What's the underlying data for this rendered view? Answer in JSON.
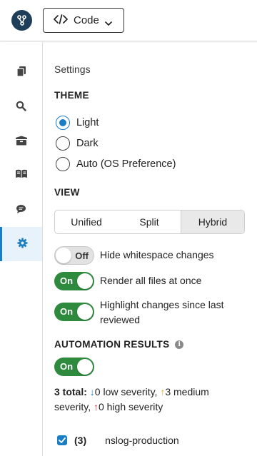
{
  "header": {
    "logo_icon": "git-branch-icon",
    "code_button": {
      "label": "Code",
      "icon": "code-brackets-icon"
    }
  },
  "sidebar": {
    "items": [
      {
        "name": "files",
        "icon": "copy-icon",
        "active": false
      },
      {
        "name": "search",
        "icon": "search-icon",
        "active": false
      },
      {
        "name": "packages",
        "icon": "box-icon",
        "active": false
      },
      {
        "name": "docs",
        "icon": "book-icon",
        "active": false
      },
      {
        "name": "comments",
        "icon": "chat-icon",
        "active": false
      },
      {
        "name": "settings",
        "icon": "gear-icon",
        "active": true
      }
    ]
  },
  "settings": {
    "title": "Settings",
    "theme": {
      "heading": "THEME",
      "options": [
        "Light",
        "Dark",
        "Auto (OS Preference)"
      ],
      "selected": "Light"
    },
    "view": {
      "heading": "VIEW",
      "options": [
        "Unified",
        "Split",
        "Hybrid"
      ],
      "selected": "Hybrid"
    },
    "toggles": [
      {
        "state": "Off",
        "label": "Hide whitespace changes"
      },
      {
        "state": "On",
        "label": "Render all files at once"
      },
      {
        "state": "On",
        "label": "Highlight changes since last reviewed"
      }
    ],
    "automation": {
      "heading": "AUTOMATION RESULTS",
      "info_icon": "info-icon",
      "toggle_state": "On",
      "total_label": "3 total:",
      "low": "0 low severity,",
      "medium": "3 medium severity,",
      "high": "0 high severity",
      "results": [
        {
          "checked": true,
          "count": "(3)",
          "name": "nslog-production"
        }
      ]
    }
  },
  "colors": {
    "accent": "#1a7ec4",
    "toggle_on": "#2e8b3e",
    "low": "#1a7ec4",
    "medium": "#e8a317",
    "high": "#d0323c"
  }
}
